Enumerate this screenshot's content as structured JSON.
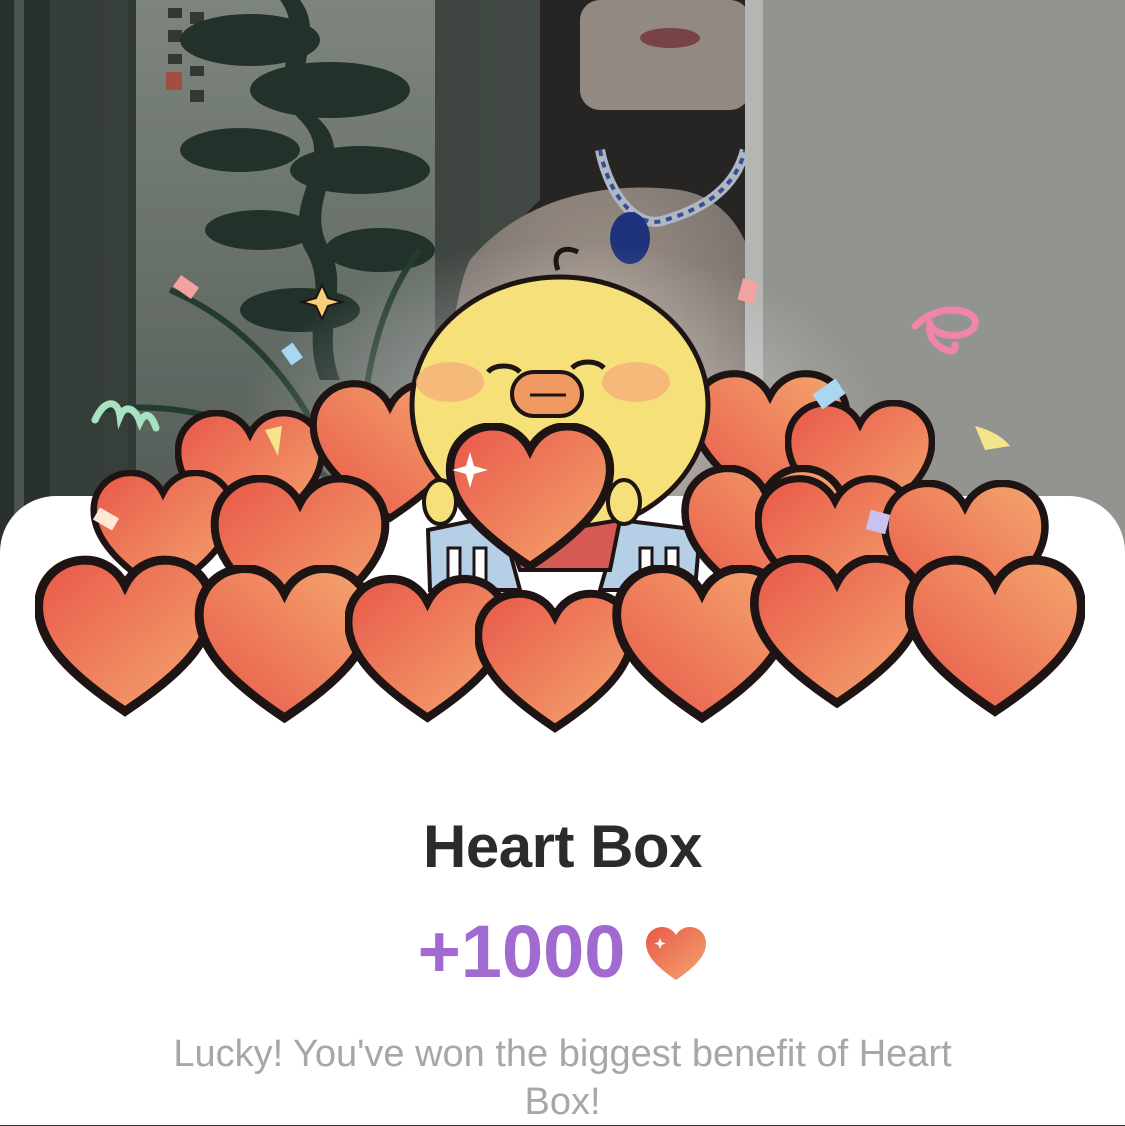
{
  "background": {
    "name": "streamer-video-background"
  },
  "reward_popup": {
    "illustration": "chick-holding-heart-in-gift-box-illustration",
    "title": "Heart Box",
    "amount": "+1000",
    "currency_icon": "heart-icon",
    "message": "Lucky! You've won the biggest benefit of Heart Box!"
  },
  "colors": {
    "sheet": "#ffffff",
    "title": "#2b2b2d",
    "amount": "#a06ad0",
    "message": "#a7a7aa",
    "heart_light": "#f2a06c",
    "heart_dark": "#e8584a",
    "chick": "#f5e07a"
  }
}
